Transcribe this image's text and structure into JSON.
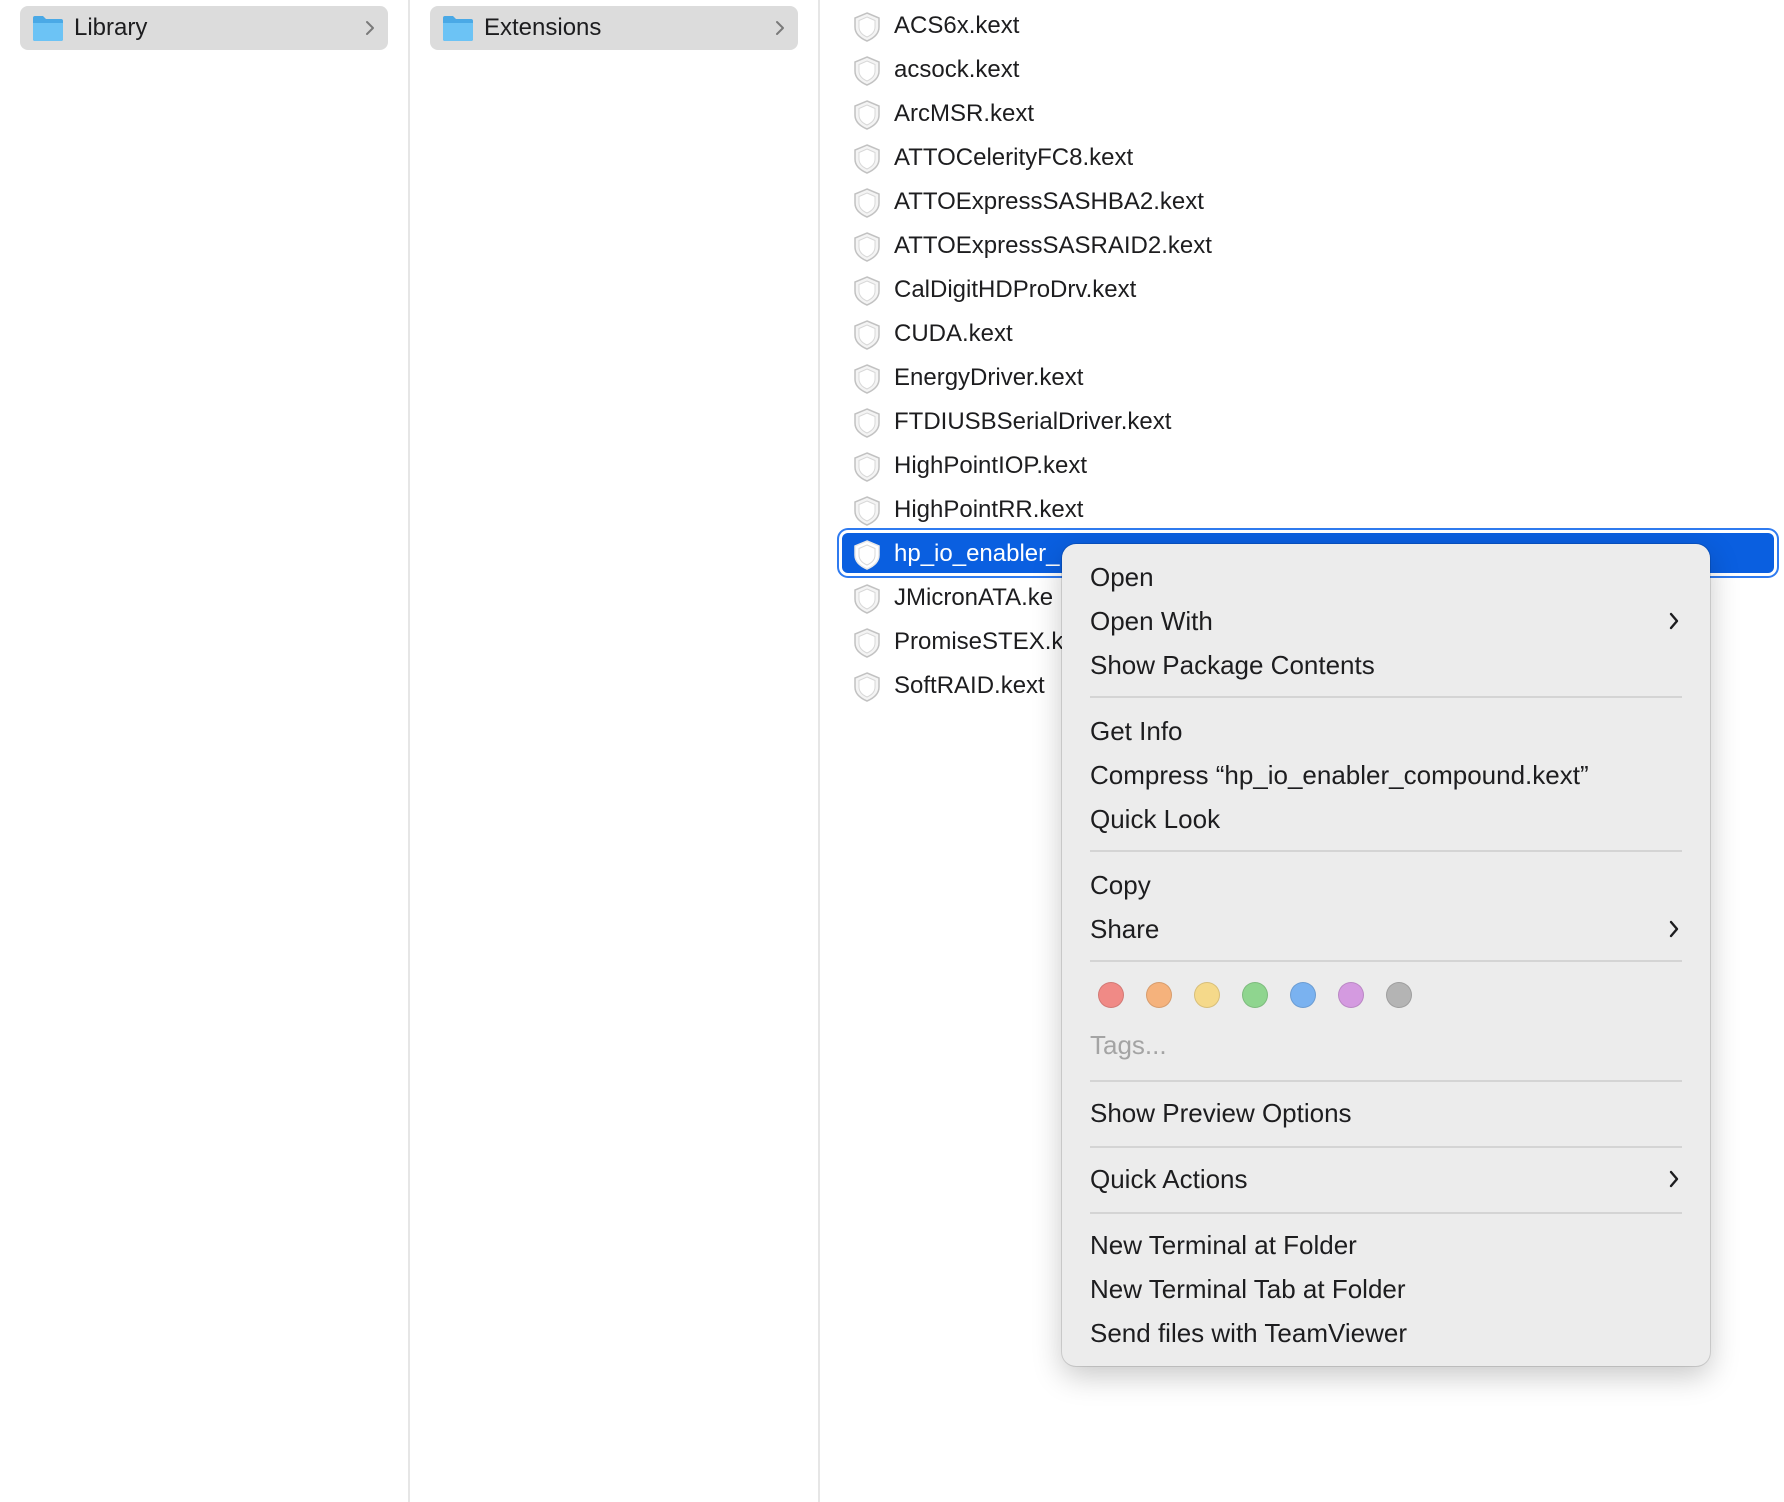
{
  "columns": [
    {
      "label": "Library",
      "icon": "folder-icon"
    },
    {
      "label": "Extensions",
      "icon": "folder-icon"
    }
  ],
  "files": [
    {
      "name": "ACS6x.kext",
      "selected": false
    },
    {
      "name": "acsock.kext",
      "selected": false
    },
    {
      "name": "ArcMSR.kext",
      "selected": false
    },
    {
      "name": "ATTOCelerityFC8.kext",
      "selected": false
    },
    {
      "name": "ATTOExpressSASHBA2.kext",
      "selected": false
    },
    {
      "name": "ATTOExpressSASRAID2.kext",
      "selected": false
    },
    {
      "name": "CalDigitHDProDrv.kext",
      "selected": false
    },
    {
      "name": "CUDA.kext",
      "selected": false
    },
    {
      "name": "EnergyDriver.kext",
      "selected": false
    },
    {
      "name": "FTDIUSBSerialDriver.kext",
      "selected": false
    },
    {
      "name": "HighPointIOP.kext",
      "selected": false
    },
    {
      "name": "HighPointRR.kext",
      "selected": false
    },
    {
      "name": "hp_io_enabler_",
      "selected": true
    },
    {
      "name": "JMicronATA.ke",
      "selected": false
    },
    {
      "name": "PromiseSTEX.k",
      "selected": false
    },
    {
      "name": "SoftRAID.kext",
      "selected": false
    }
  ],
  "context_menu": {
    "open": "Open",
    "open_with": "Open With",
    "show_package_contents": "Show Package Contents",
    "get_info": "Get Info",
    "compress": "Compress “hp_io_enabler_compound.kext”",
    "quick_look": "Quick Look",
    "copy": "Copy",
    "share": "Share",
    "tags_placeholder": "Tags...",
    "show_preview_options": "Show Preview Options",
    "quick_actions": "Quick Actions",
    "new_terminal_at_folder": "New Terminal at Folder",
    "new_terminal_tab_at_folder": "New Terminal Tab at Folder",
    "send_files_teamviewer": "Send files with TeamViewer"
  },
  "tag_colors": [
    {
      "name": "red",
      "hex": "#f08a86"
    },
    {
      "name": "orange",
      "hex": "#f5b27c"
    },
    {
      "name": "yellow",
      "hex": "#f5d98a"
    },
    {
      "name": "green",
      "hex": "#8fd58f"
    },
    {
      "name": "blue",
      "hex": "#7ab2f0"
    },
    {
      "name": "purple",
      "hex": "#d49ae0"
    },
    {
      "name": "gray",
      "hex": "#b4b4b4"
    }
  ],
  "colors": {
    "selection": "#0a5fe0",
    "folder": "#5ab8f0"
  }
}
